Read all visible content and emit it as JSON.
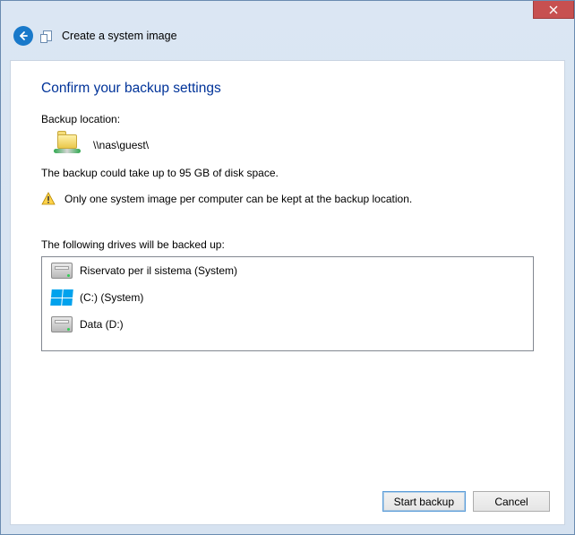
{
  "window": {
    "title": "Create a system image"
  },
  "heading": "Confirm your backup settings",
  "backup_location": {
    "label": "Backup location:",
    "path": "\\\\nas\\guest\\"
  },
  "size_estimate": "The backup could take up to 95 GB of disk space.",
  "warning": "Only one system image per computer can be kept at the backup location.",
  "drives_label": "The following drives will be backed up:",
  "drives": [
    {
      "name": "Riservato per il sistema (System)",
      "icon": "disk"
    },
    {
      "name": "(C:) (System)",
      "icon": "winlogo"
    },
    {
      "name": "Data (D:)",
      "icon": "disk"
    }
  ],
  "buttons": {
    "start": "Start backup",
    "cancel": "Cancel"
  }
}
